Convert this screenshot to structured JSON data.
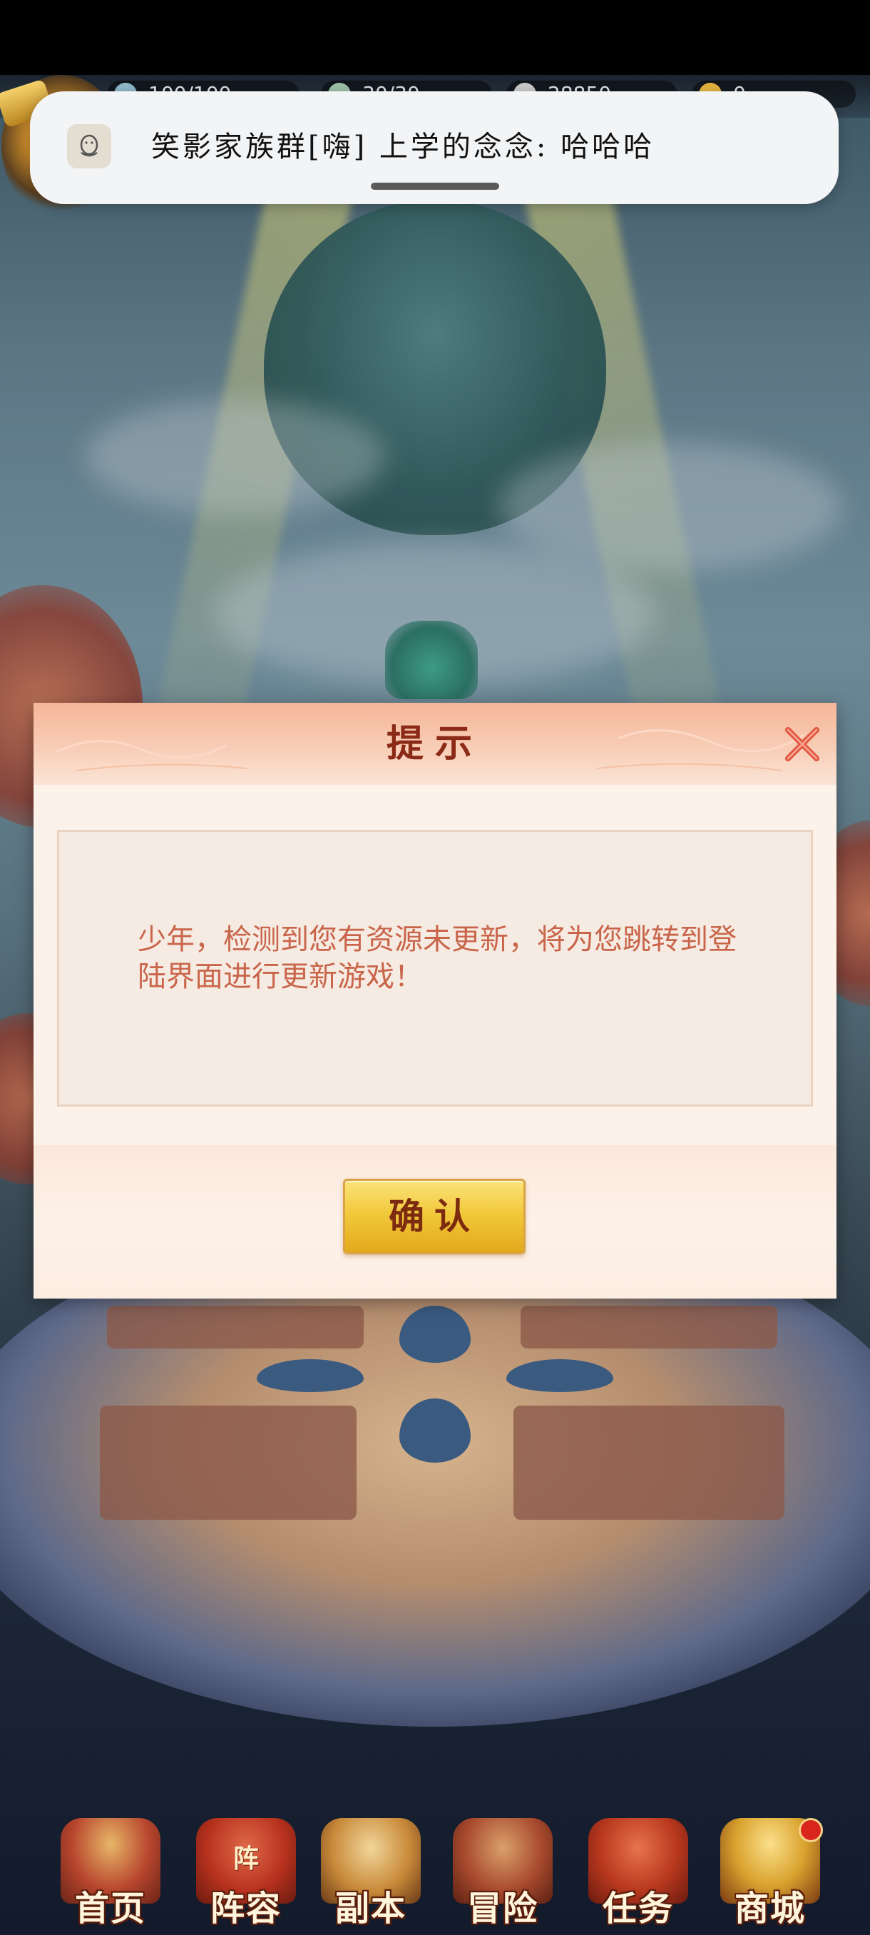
{
  "status_bar": {},
  "resources": {
    "vip_label": "",
    "stamina_label": "体",
    "stamina_value": "100/100",
    "spirit_label": "精",
    "spirit_value": "30/30",
    "coins_value": "28850",
    "ingots_value": "0"
  },
  "notification": {
    "app_icon": "penguin-icon",
    "text": "笑影家族群[嗨] 上学的念念: 哈哈哈"
  },
  "dialog": {
    "title": "提示",
    "message": "少年，检测到您有资源未更新，将为您跳转到登陆界面进行更新游戏！",
    "confirm_label": "确认",
    "close_icon": "close-x-icon"
  },
  "bottom_nav": {
    "items": [
      {
        "label": "首页",
        "sub": ""
      },
      {
        "label": "阵容",
        "sub": "阵"
      },
      {
        "label": "副本",
        "sub": ""
      },
      {
        "label": "冒险",
        "sub": ""
      },
      {
        "label": "任务",
        "sub": ""
      },
      {
        "label": "商城",
        "sub": ""
      }
    ]
  },
  "colors": {
    "dialog_bg": "#fcf2ea",
    "dialog_title": "#8b2a16",
    "message_text": "#c9654a",
    "confirm_gold": "#f2c93c",
    "close_red": "#e0523c"
  }
}
